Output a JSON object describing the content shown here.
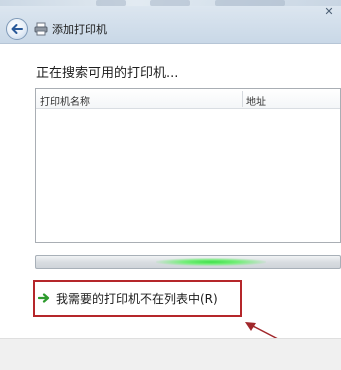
{
  "window": {
    "title": "添加打印机"
  },
  "main": {
    "heading": "正在搜索可用的打印机...",
    "columns": [
      "打印机名称",
      "地址"
    ],
    "rows": [],
    "progress_state": "searching",
    "missing_printer_link": "我需要的打印机不在列表中(R)"
  },
  "icons": {
    "back": "back-arrow-icon",
    "printer": "printer-icon",
    "link_arrow": "green-right-arrow-icon"
  },
  "colors": {
    "annotation": "#b5262a",
    "link_arrow": "#2e9b2e",
    "progress_glow": "#3fe04a"
  }
}
